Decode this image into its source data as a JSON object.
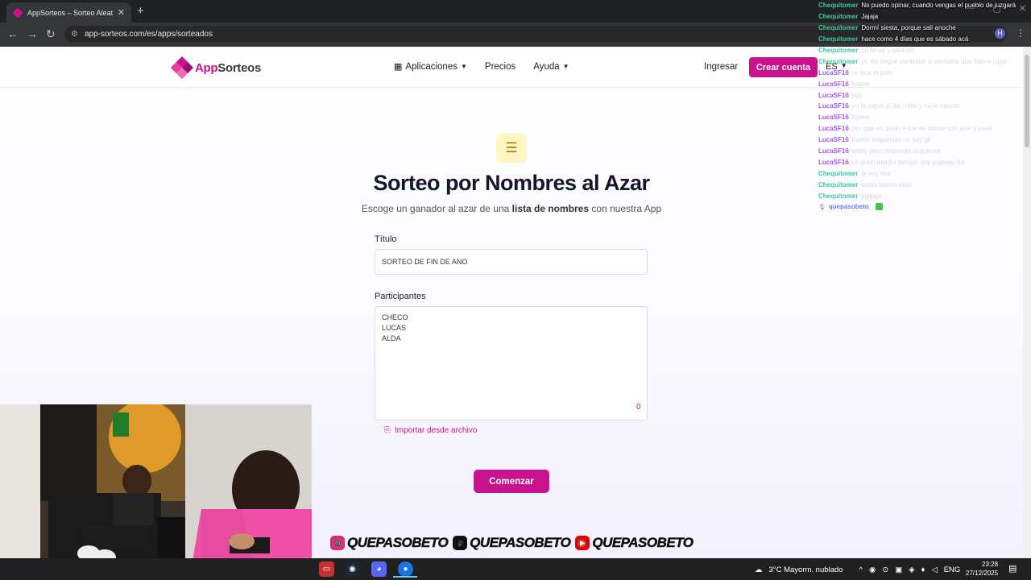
{
  "browser": {
    "tab_title": "AppSorteos – Sorteo Aleatorio",
    "tab_close": "✕",
    "new_tab": "+",
    "url": "app-sorteos.com/es/apps/sorteados",
    "profile_initial": "H",
    "nav_back": "←",
    "nav_forward": "→",
    "nav_reload": "↻",
    "menu": "⋮",
    "window_min": "—",
    "window_max": "▢",
    "window_close": "✕"
  },
  "header": {
    "brand_app": "App",
    "brand_rest": "Sorteos",
    "brand_colors": [
      "#c8128e",
      "#e2419f",
      "#9a1073",
      "#f06bb7"
    ],
    "nav": [
      {
        "label": "Aplicaciones",
        "has_dropdown": true,
        "icon": "grid-icon"
      },
      {
        "label": "Precios",
        "has_dropdown": false
      },
      {
        "label": "Ayuda",
        "has_dropdown": true
      }
    ],
    "login": "Ingresar",
    "signup": "Crear cuenta",
    "language": "ES"
  },
  "hero": {
    "icon": "list-numbered-icon",
    "title": "Sorteo por Nombres al Azar",
    "subtitle_pre": "Escoge un ganador al azar de una ",
    "subtitle_bold": "lista de nombres",
    "subtitle_post": " con nuestra App"
  },
  "form": {
    "title_label": "Título",
    "title_value": "SORTEO DE FIN DE ANO",
    "participants_label": "Participantes",
    "participants": [
      "CHECO",
      "LUCAS",
      "ALDA"
    ],
    "participants_count": "0",
    "import_label": "Importar desde archivo",
    "start_button": "Comenzar"
  },
  "chat": {
    "colors": {
      "Chequitomer": "#3dc9a2",
      "LucaSF16": "#a259e6",
      "quepasobeto": "#6b7fe3"
    },
    "messages": [
      {
        "user": "Chequitomer",
        "text": "No puedo opinar, cuando vengas el pueblo de juzgará",
        "faded": false
      },
      {
        "user": "Chequitomer",
        "text": "Jajaja",
        "faded": false
      },
      {
        "user": "Chequitomer",
        "text": "Dormí siesta, porque salí anoche",
        "faded": false
      },
      {
        "user": "Chequitomer",
        "text": "hace como 4 días que es sábado acá",
        "faded": false
      },
      {
        "user": "Chequitomer",
        "text": "Lo lucas y eleanor",
        "faded": true
      },
      {
        "user": "Chequitomer",
        "text": "yo me llegué participar si pensaba que iban a jugar",
        "faded": true
      },
      {
        "user": "LucaSF16",
        "text": "re dice el pollo",
        "faded": true
      },
      {
        "user": "LucaSF16",
        "text": "bueno",
        "faded": true
      },
      {
        "user": "LucaSF16",
        "text": "jaja",
        "faded": true
      },
      {
        "user": "LucaSF16",
        "text": "yo la regué al del rubio y no le mando",
        "faded": true
      },
      {
        "user": "LucaSF16",
        "text": "bueno",
        "faded": true
      },
      {
        "user": "LucaSF16",
        "text": "por que no, pudo estar en dónde con jose y pasé",
        "faded": true
      },
      {
        "user": "LucaSF16",
        "text": "bueno esquemas no soy gil",
        "faded": true
      },
      {
        "user": "LucaSF16",
        "text": "estoy pero respondo al quemar",
        "faded": true
      },
      {
        "user": "LucaSF16",
        "text": "un poco mucho tiempo, soy jugando fut",
        "faded": true
      },
      {
        "user": "Chequitomer",
        "text": "te voy acá",
        "faded": true
      },
      {
        "user": "Chequitomer",
        "text": "como bueno viejo",
        "faded": true
      },
      {
        "user": "Chequitomer",
        "text": "jajajaja",
        "faded": true
      },
      {
        "user": "quepasobeto",
        "text": "",
        "faded": false,
        "badge": "mic-icon",
        "emote": "emote-icon"
      }
    ]
  },
  "stream_banner": [
    {
      "platform": "instagram-icon",
      "handle": "QUEPASOBETO",
      "color": "#d62976"
    },
    {
      "platform": "tiktok-icon",
      "handle": "QUEPASOBETO",
      "color": "#111111"
    },
    {
      "platform": "youtube-icon",
      "handle": "QUEPASOBETO",
      "color": "#e00000"
    }
  ],
  "taskbar": {
    "weather": "3°C  Mayorm. nublado",
    "lang": "ENG",
    "time": "23:28",
    "date": "27/12/2025"
  }
}
